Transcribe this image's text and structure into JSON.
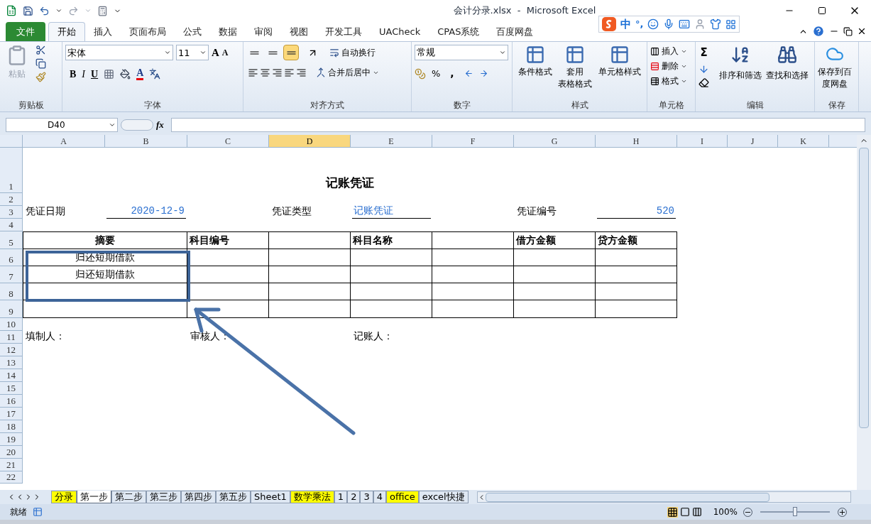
{
  "title_bar": {
    "title": "会计分录.xlsx  -  Microsoft Excel"
  },
  "ime_bar": {
    "mode": "中",
    "punctuation": "°,"
  },
  "ribbon_tabs": [
    {
      "label": "文件",
      "kind": "file",
      "selected": false
    },
    {
      "label": "开始",
      "kind": "tab",
      "selected": true
    },
    {
      "label": "插入",
      "kind": "tab",
      "selected": false
    },
    {
      "label": "页面布局",
      "kind": "tab",
      "selected": false
    },
    {
      "label": "公式",
      "kind": "tab",
      "selected": false
    },
    {
      "label": "数据",
      "kind": "tab",
      "selected": false
    },
    {
      "label": "审阅",
      "kind": "tab",
      "selected": false
    },
    {
      "label": "视图",
      "kind": "tab",
      "selected": false
    },
    {
      "label": "开发工具",
      "kind": "tab",
      "selected": false
    },
    {
      "label": "UACheck",
      "kind": "tab",
      "selected": false
    },
    {
      "label": "CPAS系统",
      "kind": "tab",
      "selected": false
    },
    {
      "label": "百度网盘",
      "kind": "tab",
      "selected": false
    }
  ],
  "ribbon": {
    "clipboard": {
      "label": "剪贴板",
      "paste": "粘贴"
    },
    "font": {
      "label": "字体",
      "font_name": "宋体",
      "font_size": "11",
      "grow": "A",
      "shrink": "A",
      "bold": "B",
      "italic": "I",
      "underline": "U",
      "font_color": "A"
    },
    "alignment": {
      "label": "对齐方式",
      "vertical": [
        {
          "selected": false
        },
        {
          "selected": false
        },
        {
          "selected": true
        }
      ],
      "wrap": "自动换行",
      "merge": "合并后居中"
    },
    "number": {
      "label": "数字",
      "format": "常规",
      "percent": "%",
      "comma": ","
    },
    "styles": {
      "label": "样式",
      "buttons": [
        {
          "lines": [
            "条件格式"
          ]
        },
        {
          "lines": [
            "套用",
            "表格格式"
          ]
        },
        {
          "lines": [
            "单元格样式"
          ]
        }
      ]
    },
    "cells": {
      "label": "单元格",
      "buttons": [
        "插入",
        "删除",
        "格式"
      ]
    },
    "editing": {
      "label": "编辑",
      "sum": "Σ",
      "buttons": [
        "排序和筛选",
        "查找和选择"
      ]
    },
    "save": {
      "label": "保存",
      "lines": [
        "保存到百",
        "度网盘"
      ]
    }
  },
  "formula_bar": {
    "name_box": "D40",
    "fx": "fx"
  },
  "sheet": {
    "columns": [
      {
        "label": "A",
        "selected": false
      },
      {
        "label": "B",
        "selected": false
      },
      {
        "label": "C",
        "selected": false
      },
      {
        "label": "D",
        "selected": true
      },
      {
        "label": "E",
        "selected": false
      },
      {
        "label": "F",
        "selected": false
      },
      {
        "label": "G",
        "selected": false
      },
      {
        "label": "H",
        "selected": false
      },
      {
        "label": "I",
        "selected": false
      },
      {
        "label": "J",
        "selected": false
      },
      {
        "label": "K",
        "selected": false
      }
    ],
    "rows": [
      "1",
      "2",
      "3",
      "4",
      "5",
      "6",
      "7",
      "8",
      "9",
      "10",
      "11",
      "12",
      "13",
      "14",
      "15",
      "16",
      "17",
      "18",
      "19",
      "20",
      "21",
      "22"
    ],
    "title": "记账凭证",
    "info": [
      {
        "label": "凭证日期",
        "value": "2020-12-9"
      },
      {
        "label": "凭证类型",
        "value": "记账凭证"
      },
      {
        "label": "凭证编号",
        "value": "520"
      }
    ],
    "table": {
      "columns": [
        {
          "heading": "摘要"
        },
        {
          "heading": "科目编号"
        },
        {},
        {
          "heading": "科目名称"
        },
        {},
        {
          "heading": "借方金额"
        },
        {
          "heading": "贷方金额"
        }
      ],
      "rows": [
        {
          "summary": "归还短期借款"
        },
        {
          "summary": "归还短期借款"
        },
        {},
        {}
      ]
    },
    "signatures": [
      "填制人：",
      "审核人：",
      "记账人："
    ]
  },
  "sheet_tabs": [
    {
      "label": "分录",
      "selected": false,
      "color": "#ffff00"
    },
    {
      "label": "第一步",
      "selected": true
    },
    {
      "label": "第二步",
      "selected": false
    },
    {
      "label": "第三步",
      "selected": false
    },
    {
      "label": "第四步",
      "selected": false
    },
    {
      "label": "第五步",
      "selected": false
    },
    {
      "label": "Sheet1",
      "selected": false
    },
    {
      "label": "数学乘法",
      "selected": false,
      "color": "#ffff00"
    },
    {
      "label": "1",
      "selected": false
    },
    {
      "label": "2",
      "selected": false
    },
    {
      "label": "3",
      "selected": false
    },
    {
      "label": "4",
      "selected": false
    },
    {
      "label": "office",
      "selected": false,
      "color": "#ffff00"
    },
    {
      "label": "excel快捷",
      "selected": false
    }
  ],
  "status_bar": {
    "state": "就绪",
    "zoom": "100%",
    "zoom_slider": {
      "level": 0.5
    }
  }
}
